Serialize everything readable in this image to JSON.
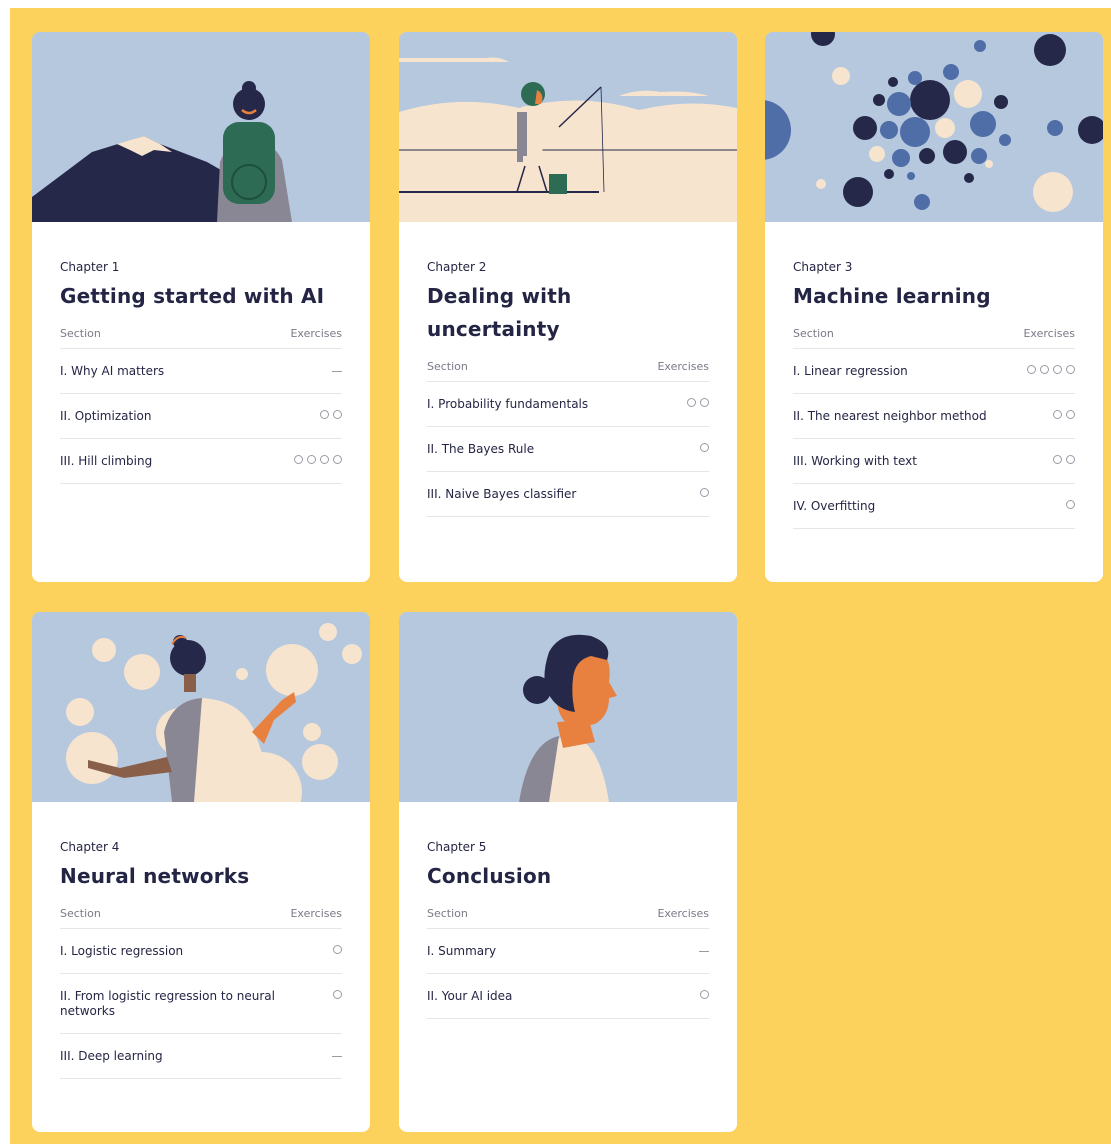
{
  "colors": {
    "background": "#fdd25c",
    "card": "#ffffff",
    "sky": "#b5c8de",
    "navy": "#242544"
  },
  "header_labels": {
    "section": "Section",
    "exercises": "Exercises"
  },
  "chapters": [
    {
      "chapter": "Chapter 1",
      "title": "Getting started with AI",
      "illustration": "hiker-mountain-illustration",
      "sections": [
        {
          "label": "I. Why AI matters",
          "exercises": 0
        },
        {
          "label": "II. Optimization",
          "exercises": 2
        },
        {
          "label": "III. Hill climbing",
          "exercises": 4
        }
      ]
    },
    {
      "chapter": "Chapter 2",
      "title": "Dealing with uncertainty",
      "illustration": "ice-fishing-illustration",
      "sections": [
        {
          "label": "I. Probability fundamentals",
          "exercises": 2
        },
        {
          "label": "II. The Bayes Rule",
          "exercises": 1
        },
        {
          "label": "III. Naive Bayes classifier",
          "exercises": 1
        }
      ]
    },
    {
      "chapter": "Chapter 3",
      "title": "Machine learning",
      "illustration": "bubble-cluster-illustration",
      "sections": [
        {
          "label": "I. Linear regression",
          "exercises": 4
        },
        {
          "label": "II. The nearest neighbor method",
          "exercises": 2
        },
        {
          "label": "III. Working with text",
          "exercises": 2
        },
        {
          "label": "IV. Overfitting",
          "exercises": 1
        }
      ]
    },
    {
      "chapter": "Chapter 4",
      "title": "Neural networks",
      "illustration": "juggler-bubbles-illustration",
      "sections": [
        {
          "label": "I. Logistic regression",
          "exercises": 1
        },
        {
          "label": "II. From logistic regression to neural networks",
          "exercises": 1
        },
        {
          "label": "III. Deep learning",
          "exercises": 0
        }
      ]
    },
    {
      "chapter": "Chapter 5",
      "title": "Conclusion",
      "illustration": "profile-portrait-illustration",
      "sections": [
        {
          "label": "I. Summary",
          "exercises": 0
        },
        {
          "label": "II. Your AI idea",
          "exercises": 1
        }
      ]
    }
  ]
}
